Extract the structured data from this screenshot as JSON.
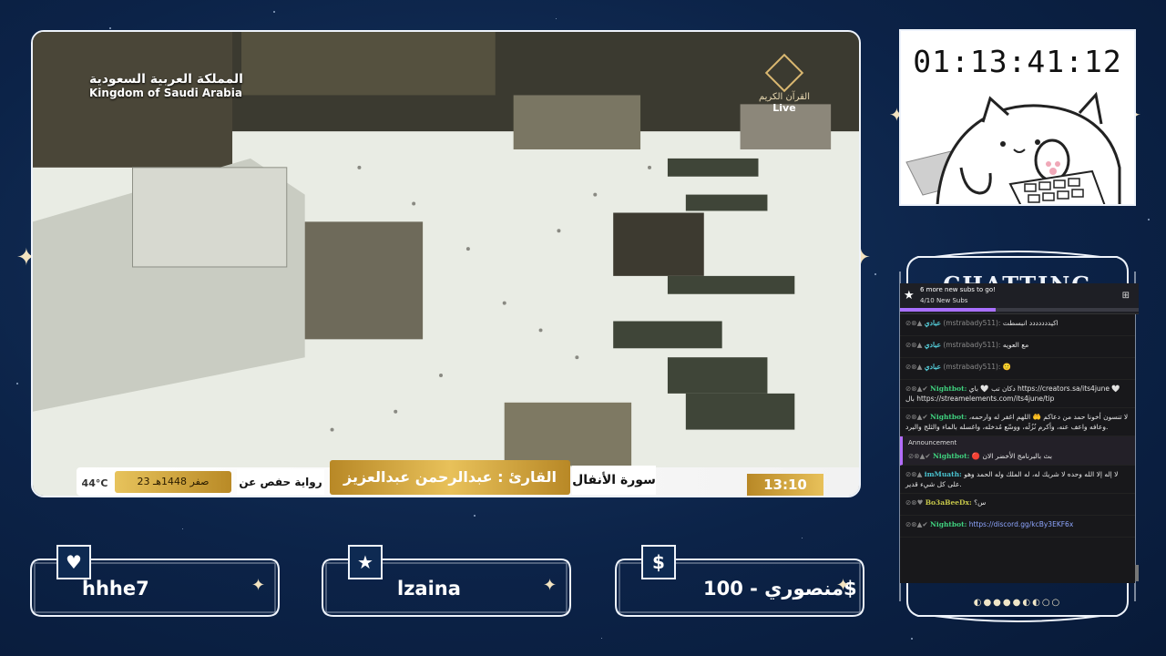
{
  "video": {
    "country_ar": "المملكة العربية السعودية",
    "country_en": "Kingdom of Saudi Arabia",
    "channel": "القرآن الكريم",
    "live_label": "Live",
    "temperature": "44°C",
    "hijri_date": "23 صفر 1448هـ",
    "narration": "رواية حفص عن عاصم",
    "reciter": "القارئ : عبدالرحمن عبدالعزيز السديس",
    "surah": "سورة الأنفال",
    "clock": "13:10"
  },
  "timer": {
    "value": "01:13:41:12"
  },
  "chat": {
    "title": "CHATTING",
    "goal": {
      "title": "6 more new subs to go!",
      "subtitle": "4/10 New Subs",
      "progress": 0.4
    },
    "messages": [
      {
        "type": "msg",
        "badges": "⊘⊗▲",
        "user": "عبادي",
        "user_class": "ar",
        "handle": "(mstrabady511):",
        "text": "اكيددددددد انبسطت"
      },
      {
        "type": "msg",
        "badges": "⊘⊗▲",
        "user": "عبادي",
        "user_class": "ar",
        "handle": "(mstrabady511):",
        "text": "مع العويه"
      },
      {
        "type": "msg",
        "badges": "⊘⊗▲",
        "user": "عبادي",
        "user_class": "ar",
        "handle": "(mstrabady511):",
        "text": "🙂"
      },
      {
        "type": "msg",
        "badges": "⊘⊗▲✔",
        "user": "Nightbot:",
        "user_class": "green",
        "text": "دكان تب 🤍 باي https://creators.sa/its4june 🤍 بال https://streamelements.com/its4june/tip"
      },
      {
        "type": "msg",
        "badges": "⊘⊗▲✔",
        "user": "Nightbot:",
        "user_class": "green",
        "text": "لا تنسون أخونا حمد من دعاكم 🤲 اللهم اغفر له وارحمه، وعافه واعف عنه، وأكرم نُزُلَه، ووسّع مُدخله، واغسله بالماء والثلج والبرد."
      },
      {
        "type": "announce",
        "head": "Announcement",
        "badges": "⊘⊗▲✔",
        "user": "Nightbot:",
        "user_class": "green",
        "text": "🔴 بث بالبرنامج الأخضر الان"
      },
      {
        "type": "msg",
        "badges": "⊘⊗▲",
        "user": "imMuath:",
        "user_class": "cyan",
        "text": "لا إله إلا الله وحده لا شريك له، له الملك وله الحمد وهو على كل شيء قدير."
      },
      {
        "type": "msg",
        "badges": "⊘⊗♥",
        "user": "Bo3aBeeDx:",
        "user_class": "olive",
        "text": "س؟"
      },
      {
        "type": "msg",
        "badges": "⊘⊗▲✔",
        "user": "Nightbot:",
        "user_class": "green",
        "text": "https://discord.gg/kcBy3EKF6x"
      }
    ],
    "dots": "◐●●●●◐◐○○"
  },
  "alerts": [
    {
      "icon": "♥",
      "icon_name": "heart-icon",
      "label": "hhhe7"
    },
    {
      "icon": "★",
      "icon_name": "star-icon",
      "label": "lzaina"
    },
    {
      "icon": "$",
      "icon_name": "dollar-icon",
      "label": "منصوري - 100$"
    }
  ]
}
